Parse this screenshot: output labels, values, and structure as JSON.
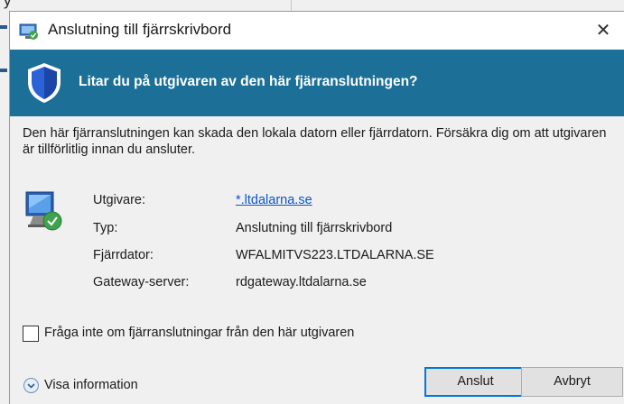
{
  "background_window": {
    "visible_text": "y"
  },
  "dialog": {
    "title": "Anslutning till fjärrskrivbord",
    "close_glyph": "✕",
    "banner_question": "Litar du på utgivaren av den här fjärranslutningen?",
    "warning_text": "Den här fjärranslutningen kan skada den lokala datorn eller fjärrdatorn. Försäkra dig om att utgivaren är tillförlitlig innan du ansluter.",
    "details": [
      {
        "label": "Utgivare:",
        "value": "*.ltdalarna.se",
        "is_link": true
      },
      {
        "label": "Typ:",
        "value": "Anslutning till fjärrskrivbord",
        "is_link": false
      },
      {
        "label": "Fjärrdator:",
        "value": "WFALMITVS223.LTDALARNA.SE",
        "is_link": false
      },
      {
        "label": "Gateway-server:",
        "value": "rdgateway.ltdalarna.se",
        "is_link": false
      }
    ],
    "checkbox": {
      "label": "Fråga inte om fjärranslutningar från den här utgivaren",
      "checked": false
    },
    "show_info_label": "Visa information",
    "buttons": {
      "connect": "Anslut",
      "cancel": "Avbryt"
    }
  },
  "colors": {
    "banner": "#1c6f96",
    "link": "#0b57c9",
    "default_button_border": "#0078d7"
  },
  "icons": [
    "remote-desktop-icon",
    "shield-icon",
    "remote-computer-icon",
    "chevron-down-icon",
    "close-icon"
  ]
}
